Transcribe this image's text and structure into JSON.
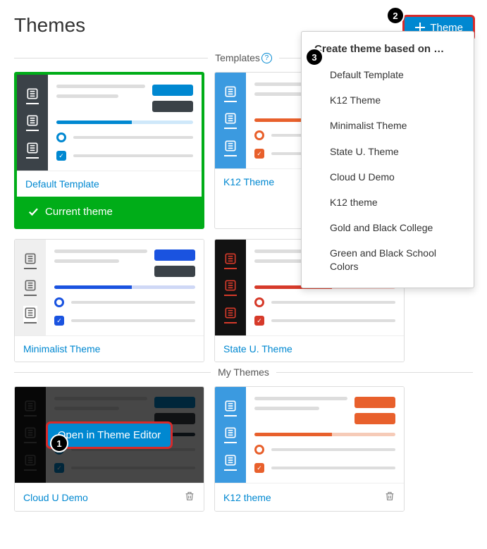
{
  "page": {
    "title": "Themes"
  },
  "buttons": {
    "add_theme": "Theme",
    "open_editor": "Open in Theme Editor"
  },
  "sections": {
    "templates": "Templates",
    "my_themes": "My Themes"
  },
  "current_label": "Current theme",
  "markers": {
    "one": "1",
    "two": "2",
    "three": "3"
  },
  "dropdown": {
    "title": "Create theme based on …",
    "items": [
      "Default Template",
      "K12 Theme",
      "Minimalist Theme",
      "State U. Theme",
      "Cloud U Demo",
      "K12 theme",
      "Gold and Black College",
      "Green and Black School Colors"
    ]
  },
  "templates": [
    {
      "name": "Default Template",
      "sidebar_bg": "#3b4248",
      "icon_color": "#ffffff",
      "bar_color": "#ffffff",
      "accent": "#0088d1",
      "pill2": "#3b4248",
      "progress_bg": "#cfe8fa",
      "active_bg": "",
      "current": true
    },
    {
      "name": "K12 Theme",
      "sidebar_bg": "#3b9ae0",
      "icon_color": "#ffffff",
      "bar_color": "#ffffff",
      "accent": "#e8602c",
      "pill2": "#e8602c",
      "progress_bg": "#f6cbb8",
      "active_bg": "",
      "current": false
    },
    {
      "name": "Minimalist Theme",
      "sidebar_bg": "#efefef",
      "icon_color": "#666666",
      "bar_color": "#666666",
      "accent": "#1a53e0",
      "pill2": "#3b4248",
      "progress_bg": "#cfd8f6",
      "active_bg": "#ffffff",
      "current": false
    },
    {
      "name": "State U. Theme",
      "sidebar_bg": "#121212",
      "icon_color": "#d63a2a",
      "bar_color": "#d63a2a",
      "accent": "#d63a2a",
      "pill2": "#121212",
      "progress_bg": "#f5c7c0",
      "active_bg": "",
      "current": false
    }
  ],
  "my_themes": [
    {
      "name": "Cloud U Demo",
      "sidebar_bg": "#1b1b1b",
      "icon_color": "#666666",
      "bar_color": "#666666",
      "accent": "#0088d1",
      "pill2": "#3b4248",
      "progress_bg": "#2a3a4a",
      "overlay": true
    },
    {
      "name": "K12 theme",
      "sidebar_bg": "#3b9ae0",
      "icon_color": "#ffffff",
      "bar_color": "#ffffff",
      "accent": "#e8602c",
      "pill2": "#e8602c",
      "progress_bg": "#f6cbb8",
      "overlay": false
    }
  ]
}
